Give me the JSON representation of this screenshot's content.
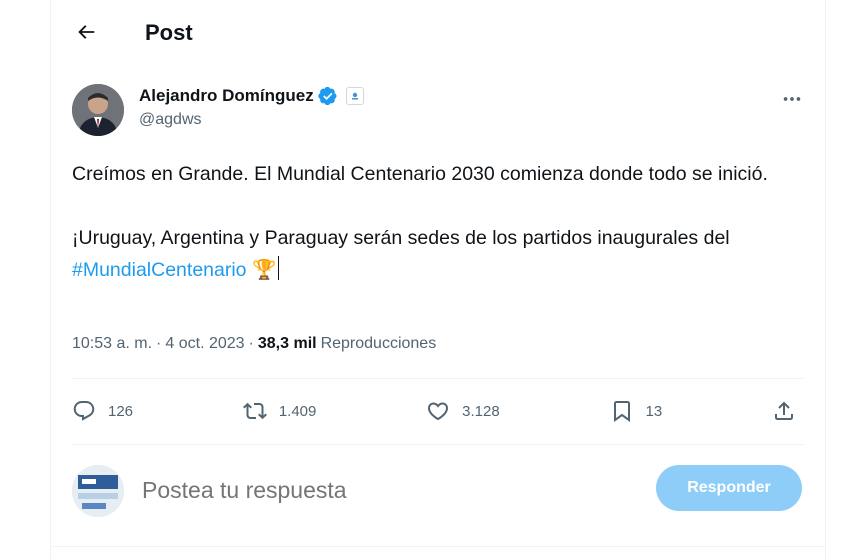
{
  "header": {
    "title": "Post",
    "back_icon": "arrow-left-icon"
  },
  "author": {
    "display_name": "Alejandro Domínguez",
    "handle": "@agdws",
    "verified": true,
    "verified_color": "#1d9bf0"
  },
  "tweet": {
    "line1": "Creímos en Grande. El Mundial Centenario 2030 comienza donde todo se inició.",
    "line2": "¡Uruguay, Argentina y Paraguay serán sedes de los partidos inaugurales del ",
    "hashtag": "#MundialCentenario",
    "emoji": "🏆",
    "hashtag_color": "#1d9bf0"
  },
  "meta": {
    "time": "10:53 a. m.",
    "separator1": "·",
    "date": "4 oct. 2023",
    "separator2": "·",
    "views_count": "38,3 mil",
    "views_label": "Reproducciones"
  },
  "actions": {
    "replies": "126",
    "reposts": "1.409",
    "likes": "3.128",
    "bookmarks": "13"
  },
  "reply_box": {
    "placeholder": "Postea tu respuesta",
    "button_label": "Responder",
    "button_color": "#8ecdf8"
  }
}
